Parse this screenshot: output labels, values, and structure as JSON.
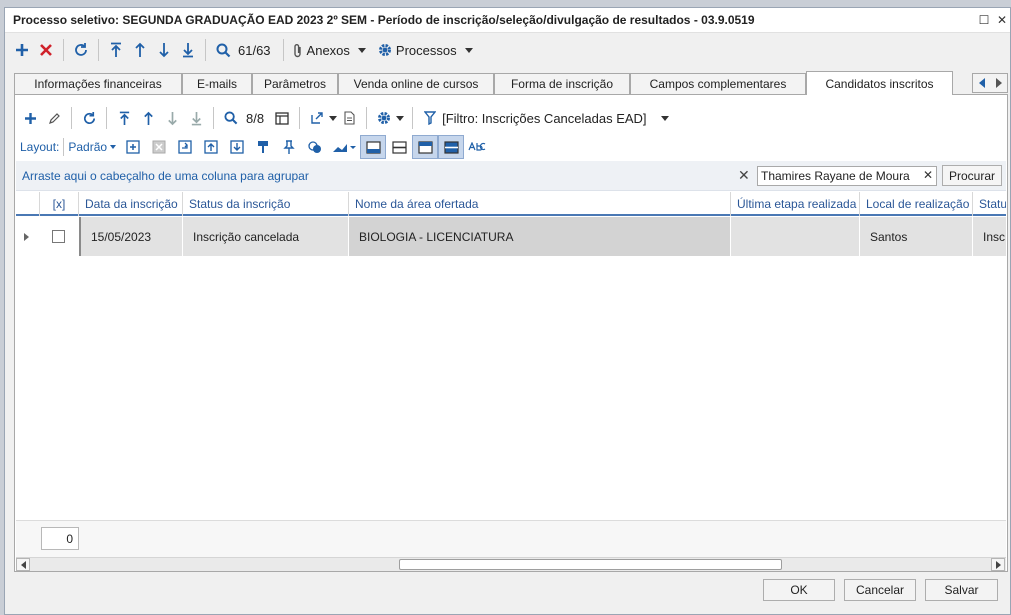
{
  "window": {
    "title": "Processo seletivo: SEGUNDA GRADUAÇÃO EAD 2023 2º SEM - Período de inscrição/seleção/divulgação de resultados - 03.9.0519",
    "maximize_glyph": "☐",
    "close_glyph": "✕"
  },
  "main_toolbar": {
    "record_position": "61/63",
    "anexos_label": "Anexos",
    "processos_label": "Processos"
  },
  "tabs": [
    {
      "label": "Informações financeiras",
      "active": false
    },
    {
      "label": "E-mails",
      "active": false
    },
    {
      "label": "Parâmetros",
      "active": false
    },
    {
      "label": "Venda online de cursos",
      "active": false
    },
    {
      "label": "Forma de inscrição",
      "active": false
    },
    {
      "label": "Campos complementares",
      "active": false
    },
    {
      "label": "Candidatos inscritos",
      "active": true
    }
  ],
  "panel_toolbar": {
    "record_position": "8/8",
    "filter_label": "[Filtro: Inscrições Canceladas EAD]"
  },
  "layout_bar": {
    "label": "Layout:",
    "layout_value": "Padrão"
  },
  "group_bar": {
    "hint": "Arraste aqui o cabeçalho de uma coluna para agrupar",
    "search_value": "Thamires Rayane de Moura",
    "search_button": "Procurar"
  },
  "grid": {
    "columns": [
      "[x]",
      "Data da inscrição",
      "Status da inscrição",
      "Nome da área ofertada",
      "Última etapa realizada",
      "Local de realização",
      "Statu"
    ],
    "rows": [
      {
        "date": "15/05/2023",
        "status": "Inscrição cancelada",
        "area": "BIOLOGIA - LICENCIATURA",
        "last_step": "",
        "location": "Santos",
        "status2": "Insc"
      }
    ]
  },
  "footer": {
    "count": "0"
  },
  "buttons": {
    "ok": "OK",
    "cancel": "Cancelar",
    "save": "Salvar"
  },
  "colors": {
    "accent_blue": "#2060a8",
    "delete_red": "#d0212a",
    "row_background": "#e2e2e2",
    "header_underline": "#4a78b4"
  }
}
